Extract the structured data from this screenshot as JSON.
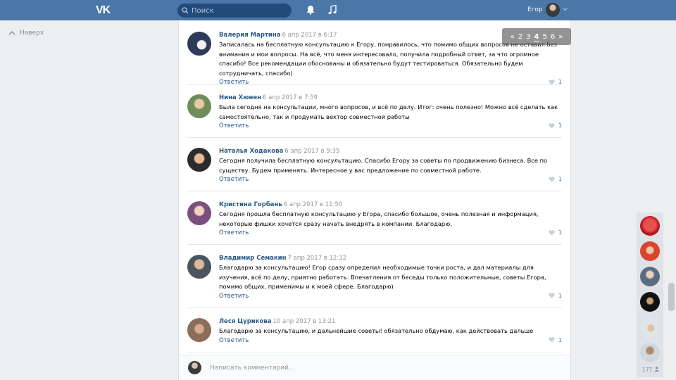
{
  "header": {
    "logo_text": "VK",
    "search_placeholder": "Поиск",
    "user_name": "Егор"
  },
  "left_nav": {
    "back_label": "Наверх"
  },
  "pagination": {
    "prev": "«",
    "pages": [
      "2",
      "3",
      "4",
      "5",
      "6"
    ],
    "current": "4",
    "next": "»"
  },
  "comments": [
    {
      "author": "Валерия Мартина",
      "date": "6 апр 2017 в 6:17",
      "text": "Записалась на бесплатную консультацию к Егору, понравилось, что помимо общих вопросов не оставил без внимания и мои вопросы. На всё, что меня интересовало, получила подробный ответ, за что огромное спасибо! Все рекомендации обоснованы и обязательно будут тестироваться. Обязательно будем сотрудничать, спасибо)",
      "reply": "Ответить",
      "likes": "1"
    },
    {
      "author": "Нина Хюнен",
      "date": "6 апр 2017 в 7:59",
      "text": "Была сегодня на консультации, много вопросов, и всё по делу. Итог: очень полезно! Можно всё сделать как самостоятельно, так и продумать вектор совместной работы",
      "reply": "Ответить",
      "likes": "1"
    },
    {
      "author": "Наталья Ходакова",
      "date": "6 апр 2017 в 9:35",
      "text": "Сегодня получила бесплатную консультацию. Спасибо Егору за советы по продвижению бизнеса. Все по существу. Будем применять. Интересное у вас предложение по совместной работе.",
      "reply": "Ответить",
      "likes": "1"
    },
    {
      "author": "Кристина Горбань",
      "date": "6 апр 2017 в 11:50",
      "text": "Сегодня прошла бесплатную консультацию у Егора, спасибо большое, очень полезная и информация, некоторые фишки хочется сразу начать внедрять в компании. Благодарю.",
      "reply": "Ответить",
      "likes": "1"
    },
    {
      "author": "Владимир Семакин",
      "date": "7 апр 2017 в 12:32",
      "text": "Благодарю за консультацию! Егор сразу определил необходимые точки роста, и дал материалы для изучения, всё по делу, приятно работать. Впечатления от беседы только положительные, советы Егора, помимо общих, применимы и к моей сфере. Благодарю)",
      "reply": "Ответить",
      "likes": "1"
    },
    {
      "author": "Леся Цурикова",
      "date": "10 апр 2017 в 13:21",
      "text": "Благодарю за консультацию, и дальнейшие советы! обязательно обдумаю, как действовать дальше",
      "reply": "Ответить",
      "likes": "1"
    }
  ],
  "write_bar": {
    "placeholder": "Написать комментарий..."
  },
  "chat_panel": {
    "online_count": "177"
  },
  "colors": {
    "header": "#4a76a8",
    "link": "#2a5885",
    "background": "#edeef0"
  }
}
